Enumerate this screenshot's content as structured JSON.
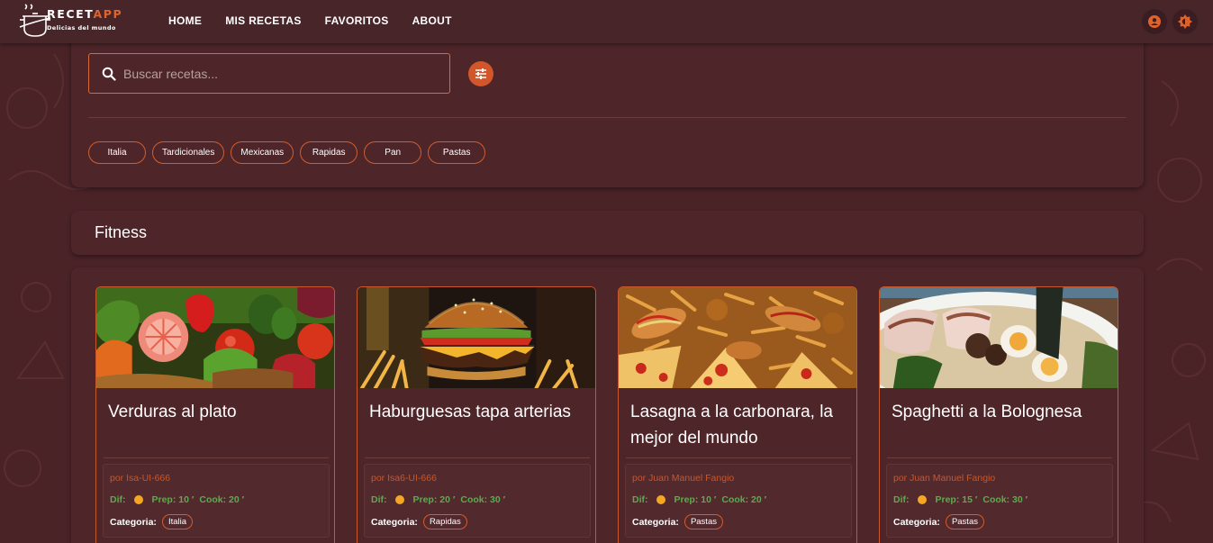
{
  "header": {
    "brand_main": "RECET",
    "brand_accent": "APP",
    "tagline": "Delicias del mundo",
    "nav": [
      "HOME",
      "MIS RECETAS",
      "FAVORITOS",
      "ABOUT"
    ],
    "icons": [
      "account-icon",
      "theme-toggle-icon"
    ]
  },
  "search": {
    "placeholder": "Buscar recetas...",
    "value": "",
    "icon": "search-icon",
    "filter_icon": "tune-icon"
  },
  "chips": [
    "Italia",
    "Tardicionales",
    "Mexicanas",
    "Rapidas",
    "Pan",
    "Pastas"
  ],
  "section": {
    "title": "Fitness"
  },
  "cards": [
    {
      "title": "Verduras al plato",
      "author": "por Isa-UI-666",
      "dif_label": "Dif:",
      "prep": "Prep: 10 ′",
      "cook": "Cook: 20 ′",
      "category_label": "Categoria:",
      "category": "Italia"
    },
    {
      "title": "Haburguesas tapa arterias",
      "author": "por Isa6-UI-666",
      "dif_label": "Dif:",
      "prep": "Prep: 20 ′",
      "cook": "Cook: 30 ′",
      "category_label": "Categoria:",
      "category": "Rapidas"
    },
    {
      "title": "Lasagna a la carbonara, la mejor del mundo",
      "author": "por Juan Manuel Fangio",
      "dif_label": "Dif:",
      "prep": "Prep: 10 ′",
      "cook": "Cook: 20 ′",
      "category_label": "Categoria:",
      "category": "Pastas"
    },
    {
      "title": "Spaghetti a la Bolognesa",
      "author": "por Juan Manuel Fangio",
      "dif_label": "Dif:",
      "prep": "Prep: 15 ′",
      "cook": "Cook: 30 ′",
      "category_label": "Categoria:",
      "category": "Pastas"
    }
  ],
  "colors": {
    "background": "#4a2327",
    "panel": "#4e2529",
    "accent": "#d2562a",
    "stats_green": "#5cab4e",
    "difficulty_dot": "#f5a623"
  }
}
